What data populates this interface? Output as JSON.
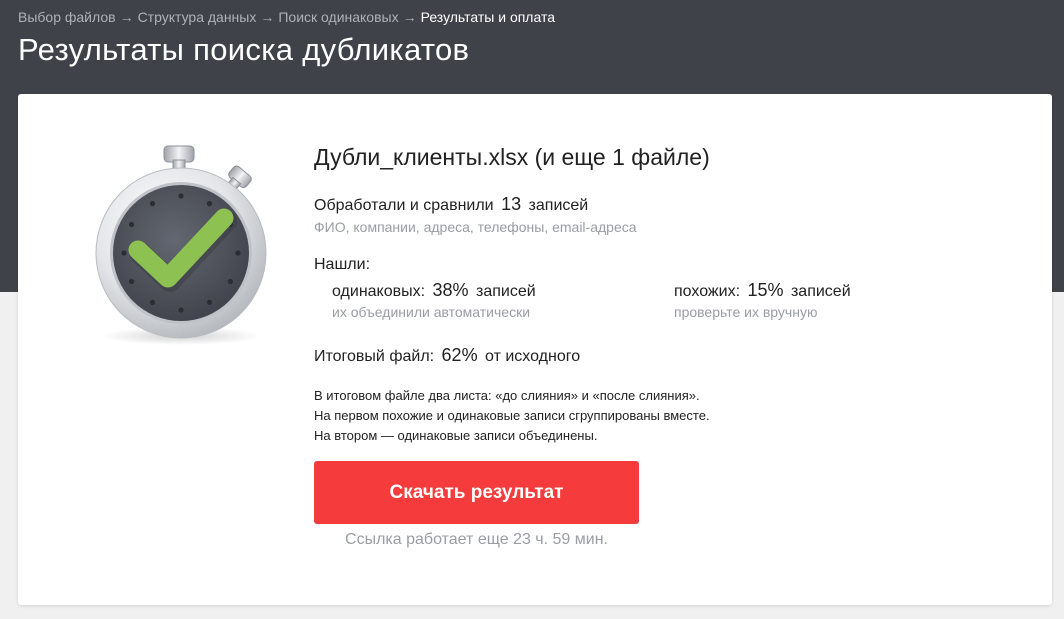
{
  "breadcrumb": {
    "steps": [
      "Выбор файлов",
      "Структура данных",
      "Поиск одинаковых",
      "Результаты и оплата"
    ],
    "separator": "→"
  },
  "page": {
    "title": "Результаты поиска дубликатов"
  },
  "result": {
    "file_title": "Дубли_клиенты.xlsx (и еще 1 файле)",
    "processed_prefix": "Обработали и сравнили",
    "processed_count": "13",
    "processed_suffix": "записей",
    "fields_note": "ФИО, компании, адреса, телефоны, email-адреса",
    "found_label": "Нашли:",
    "same": {
      "prefix": "одинаковых:",
      "value": "38%",
      "suffix": "записей",
      "note": "их объединили автоматически"
    },
    "similar": {
      "prefix": "похожих:",
      "value": "15%",
      "suffix": "записей",
      "note": "проверьте их вручную"
    },
    "final_prefix": "Итоговый файл:",
    "final_value": "62%",
    "final_suffix": "от исходного",
    "explain_lines": [
      "В итоговом файле два листа: «до слияния» и «после слияния».",
      "На первом похожие и одинаковые записи сгруппированы вместе.",
      "На втором — одинаковые записи объединены."
    ],
    "download_label": "Скачать результат",
    "link_expiry": "Ссылка работает еще 23 ч. 59 мин."
  },
  "colors": {
    "header_bg": "#3f4249",
    "accent_button": "#f53b3c",
    "check_green": "#8dc152",
    "muted_text": "#9a9da3"
  },
  "icons": {
    "hero": "stopwatch-check-icon"
  }
}
